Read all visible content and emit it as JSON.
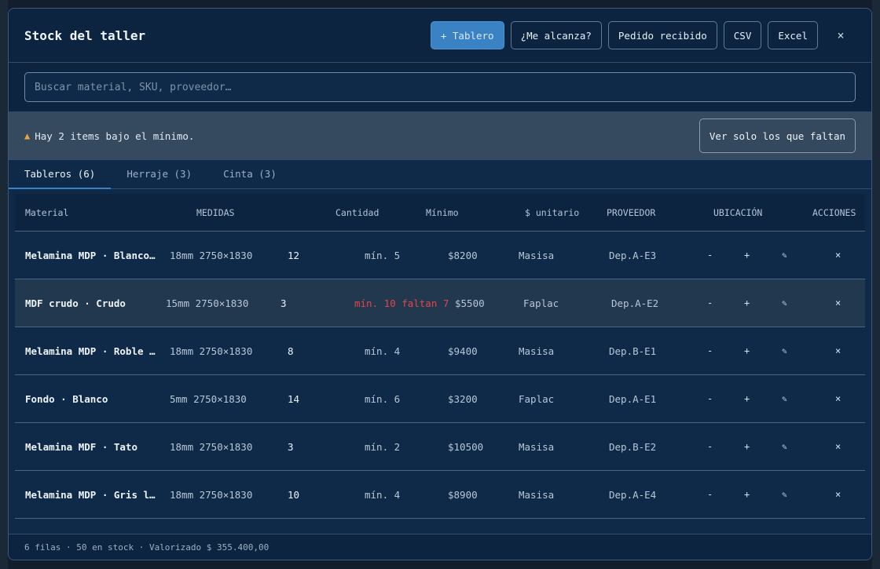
{
  "header": {
    "title": "Stock del taller",
    "buttons": {
      "add_board": "+ Tablero",
      "enough": "¿Me alcanza?",
      "order_received": "Pedido recibido",
      "csv": "CSV",
      "excel": "Excel",
      "close": "×"
    }
  },
  "search": {
    "placeholder": "Buscar material, SKU, proveedor…",
    "value": ""
  },
  "alert": {
    "icon": "warning-icon",
    "text": "Hay 2 items bajo el mínimo.",
    "button": "Ver solo los que faltan"
  },
  "tabs": [
    {
      "label": "Tableros (6)",
      "active": true
    },
    {
      "label": "Herraje (3)",
      "active": false
    },
    {
      "label": "Cinta (3)",
      "active": false
    }
  ],
  "table": {
    "columns": [
      "Material",
      "MEDIDAS",
      "Cantidad",
      "Mínimo",
      "$ unitario",
      "PROVEEDOR",
      "UBICACIÓN",
      "ACCIONES"
    ],
    "actions": {
      "minus": "-",
      "plus": "+",
      "edit": "✎",
      "delete": "×"
    },
    "rows": [
      {
        "material": "Melamina MDP · Blanco…",
        "medidas": "18mm 2750×1830",
        "cantidad": "12",
        "minimo": "mín. 5",
        "precio": "$8200",
        "proveedor": "Masisa",
        "ubicacion": "Dep.A-E3",
        "low": false
      },
      {
        "material": "MDF crudo · Crudo",
        "medidas": "15mm 2750×1830",
        "cantidad": "3",
        "minimo": "mín. 10 faltan 7",
        "precio": "$5500",
        "proveedor": "Faplac",
        "ubicacion": "Dep.A-E2",
        "low": true
      },
      {
        "material": "Melamina MDP · Roble …",
        "medidas": "18mm 2750×1830",
        "cantidad": "8",
        "minimo": "mín. 4",
        "precio": "$9400",
        "proveedor": "Masisa",
        "ubicacion": "Dep.B-E1",
        "low": false
      },
      {
        "material": "Fondo · Blanco",
        "medidas": "5mm 2750×1830",
        "cantidad": "14",
        "minimo": "mín. 6",
        "precio": "$3200",
        "proveedor": "Faplac",
        "ubicacion": "Dep.A-E1",
        "low": false
      },
      {
        "material": "Melamina MDF · Tato",
        "medidas": "18mm 2750×1830",
        "cantidad": "3",
        "minimo": "mín. 2",
        "precio": "$10500",
        "proveedor": "Masisa",
        "ubicacion": "Dep.B-E2",
        "low": false
      },
      {
        "material": "Melamina MDP · Gris l…",
        "medidas": "18mm 2750×1830",
        "cantidad": "10",
        "minimo": "mín. 4",
        "precio": "$8900",
        "proveedor": "Masisa",
        "ubicacion": "Dep.A-E4",
        "low": false
      }
    ]
  },
  "footer": {
    "summary": "6 filas · 50 en stock · Valorizado $ 355.400,00"
  },
  "colors": {
    "accent": "#3b82c4",
    "warning": "#e6a640",
    "danger": "#e0474a"
  }
}
